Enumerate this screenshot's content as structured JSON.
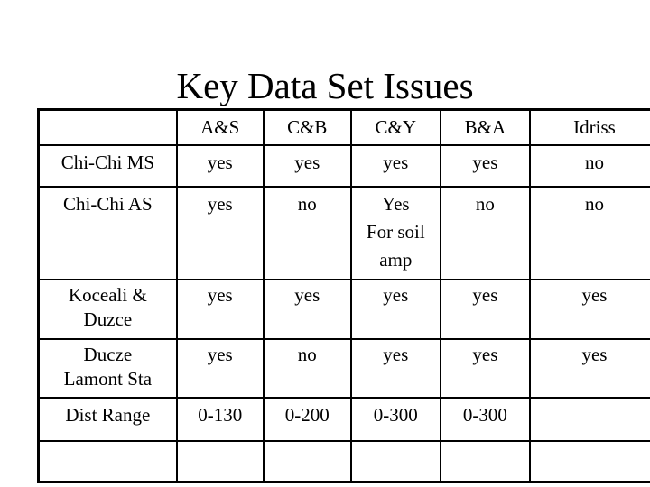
{
  "slide": {
    "title": "Key Data Set Issues"
  },
  "table": {
    "columns": [
      "",
      "A&S",
      "C&B",
      "C&Y",
      "B&A",
      "Idriss"
    ],
    "rows": [
      {
        "label": "Chi-Chi MS",
        "cells": [
          "yes",
          "yes",
          "yes",
          "yes",
          "no"
        ]
      },
      {
        "label": "Chi-Chi AS",
        "cells": [
          "yes",
          "no",
          "Yes\nFor soil\namp",
          "no",
          "no"
        ],
        "cy_lines": [
          "Yes",
          "For soil",
          "amp"
        ]
      },
      {
        "label": "Koceali & Duzce",
        "label_lines": [
          "Koceali &",
          "Duzce"
        ],
        "cells": [
          "yes",
          "yes",
          "yes",
          "yes",
          "yes"
        ]
      },
      {
        "label": "Ducze Lamont Sta",
        "label_lines": [
          "Ducze",
          "Lamont Sta"
        ],
        "cells": [
          "yes",
          "no",
          "yes",
          "yes",
          "yes"
        ]
      },
      {
        "label": "Dist Range",
        "cells": [
          "0-130",
          "0-200",
          "0-300",
          "0-300",
          ""
        ]
      },
      {
        "label": "",
        "cells": [
          "",
          "",
          "",
          "",
          ""
        ]
      }
    ]
  }
}
